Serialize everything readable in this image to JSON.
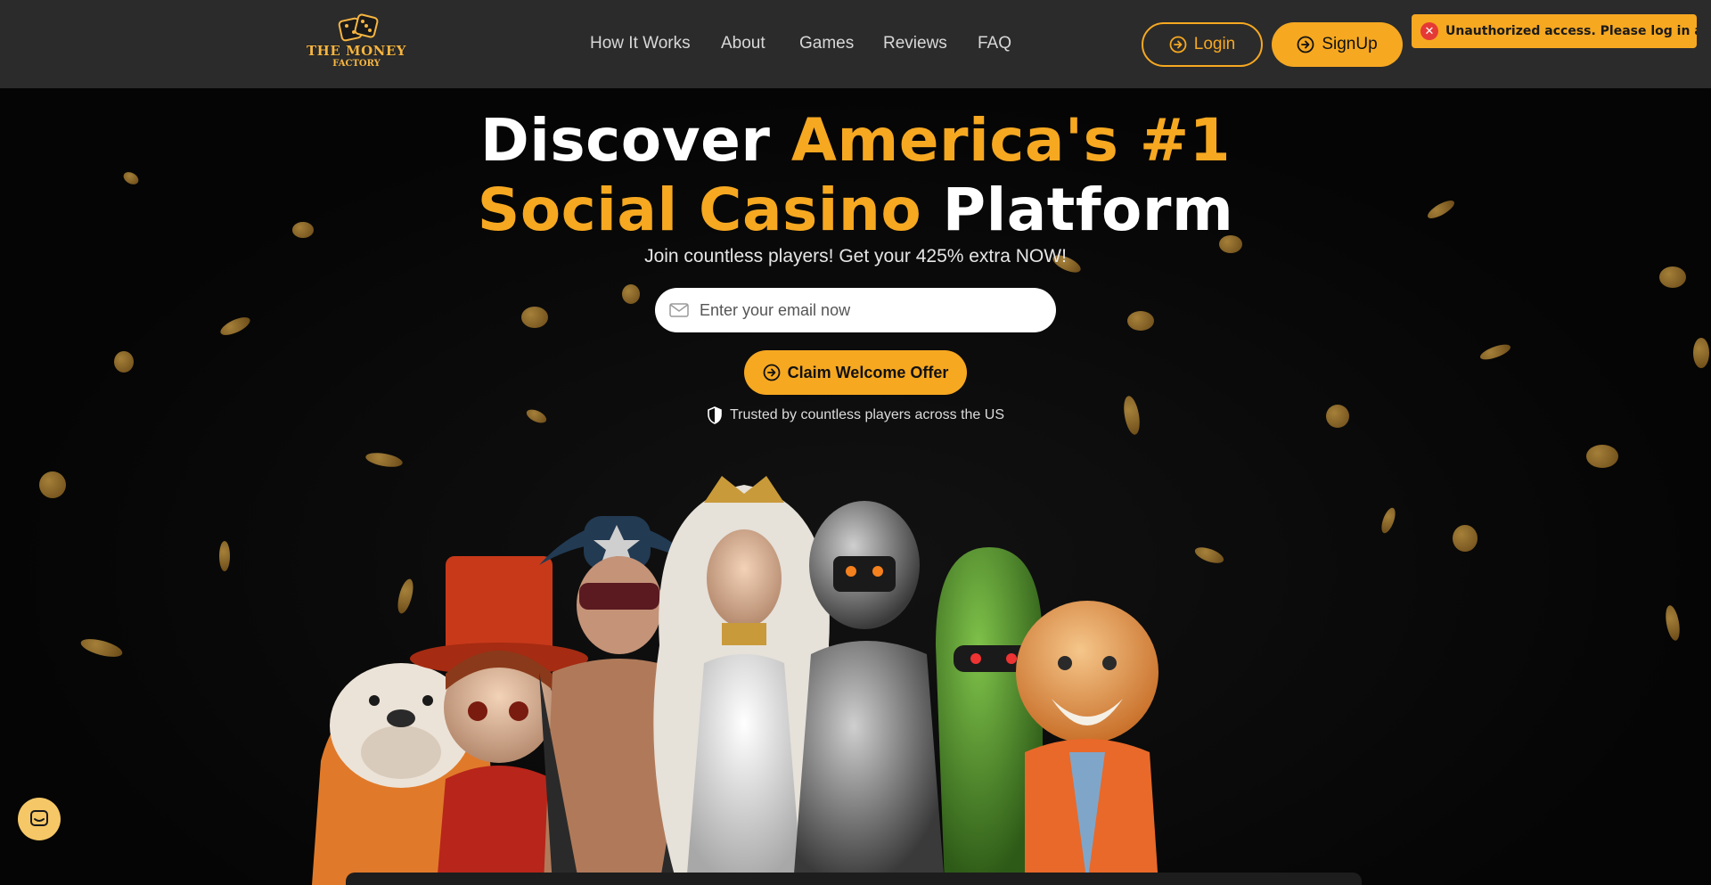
{
  "brand": {
    "line1": "THE MONEY",
    "line2": "FACTORY"
  },
  "nav": {
    "items": [
      "How It Works",
      "About",
      "Games",
      "Reviews",
      "FAQ"
    ]
  },
  "auth": {
    "login_label": "Login",
    "signup_label": "SignUp"
  },
  "toast": {
    "message": "Unauthorized access. Please log in again."
  },
  "hero": {
    "title_part1": "Discover",
    "title_part2": "America's #1",
    "title_part3": "Social Casino",
    "title_part4": "Platform",
    "subtitle": "Join countless players! Get your 425% extra NOW!",
    "email_placeholder": "Enter your email now",
    "cta_label": "Claim Welcome Offer",
    "trust_text": "Trusted by countless players across the US"
  },
  "colors": {
    "accent": "#f6a821",
    "header_bg": "#2b2b2b",
    "page_bg": "#050505",
    "error": "#e53935"
  },
  "icons": {
    "login": "circle-arrow-right-icon",
    "signup": "circle-arrow-right-icon",
    "toast": "error-x-icon",
    "email": "mail-icon",
    "cta": "circle-arrow-right-icon",
    "trust": "shield-icon",
    "chat": "chat-icon"
  }
}
